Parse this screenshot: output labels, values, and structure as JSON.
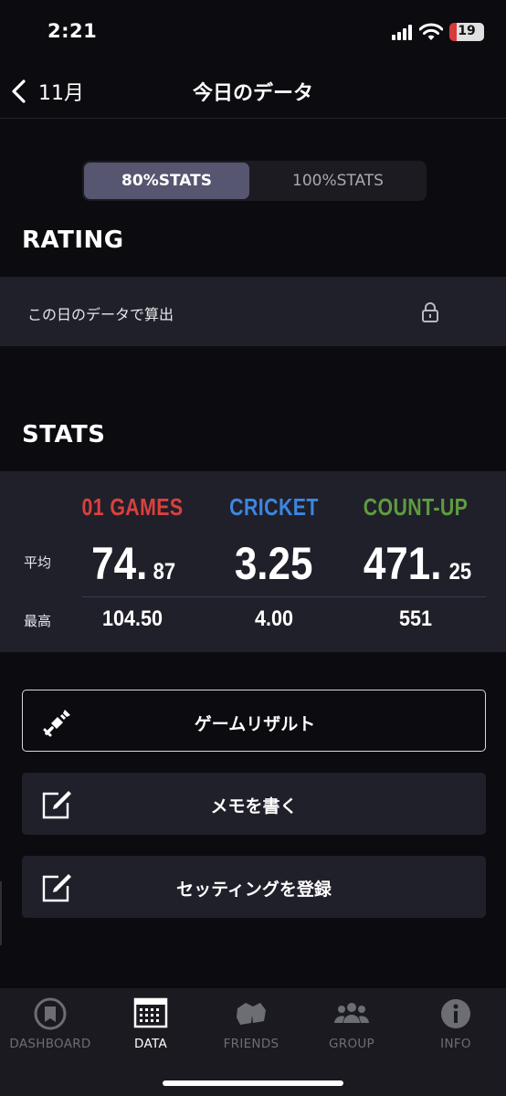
{
  "status_bar": {
    "time": "2:21",
    "battery": "19"
  },
  "nav": {
    "back_label": "11月",
    "title": "今日のデータ"
  },
  "stats_toggle": {
    "options": [
      "80%STATS",
      "100%STATS"
    ],
    "selected": "80%STATS"
  },
  "rating": {
    "heading": "RATING",
    "text": "この日のデータで算出",
    "icon": "lock-icon"
  },
  "stats": {
    "heading": "STATS",
    "avg_label": "平均",
    "max_label": "最高",
    "columns": [
      {
        "name": "01 GAMES",
        "color": "#d9413f",
        "avg_int": "74.",
        "avg_dec": "87",
        "max": "104.50"
      },
      {
        "name": "CRICKET",
        "color": "#3d86e0",
        "avg_int": "3.25",
        "avg_dec": "",
        "max": "4.00"
      },
      {
        "name": "COUNT-UP",
        "color": "#5e9c3f",
        "avg_int": "471.",
        "avg_dec": "25",
        "max": "551"
      }
    ]
  },
  "actions": [
    {
      "label": "ゲームリザルト",
      "icon": "dart-icon"
    },
    {
      "label": "メモを書く",
      "icon": "edit-icon"
    },
    {
      "label": "セッティングを登録",
      "icon": "edit-icon"
    }
  ],
  "tab_bar": {
    "tabs": [
      {
        "label": "DASHBOARD",
        "icon": "dashboard-icon",
        "active": false
      },
      {
        "label": "DATA",
        "icon": "calendar-icon",
        "active": true
      },
      {
        "label": "FRIENDS",
        "icon": "friends-icon",
        "active": false
      },
      {
        "label": "GROUP",
        "icon": "group-icon",
        "active": false
      },
      {
        "label": "INFO",
        "icon": "info-icon",
        "active": false
      }
    ]
  },
  "colors": {
    "background": "#0c0b10",
    "panel": "#20202a",
    "segment_active": "#565670",
    "battery_low": "#d83a3a"
  }
}
